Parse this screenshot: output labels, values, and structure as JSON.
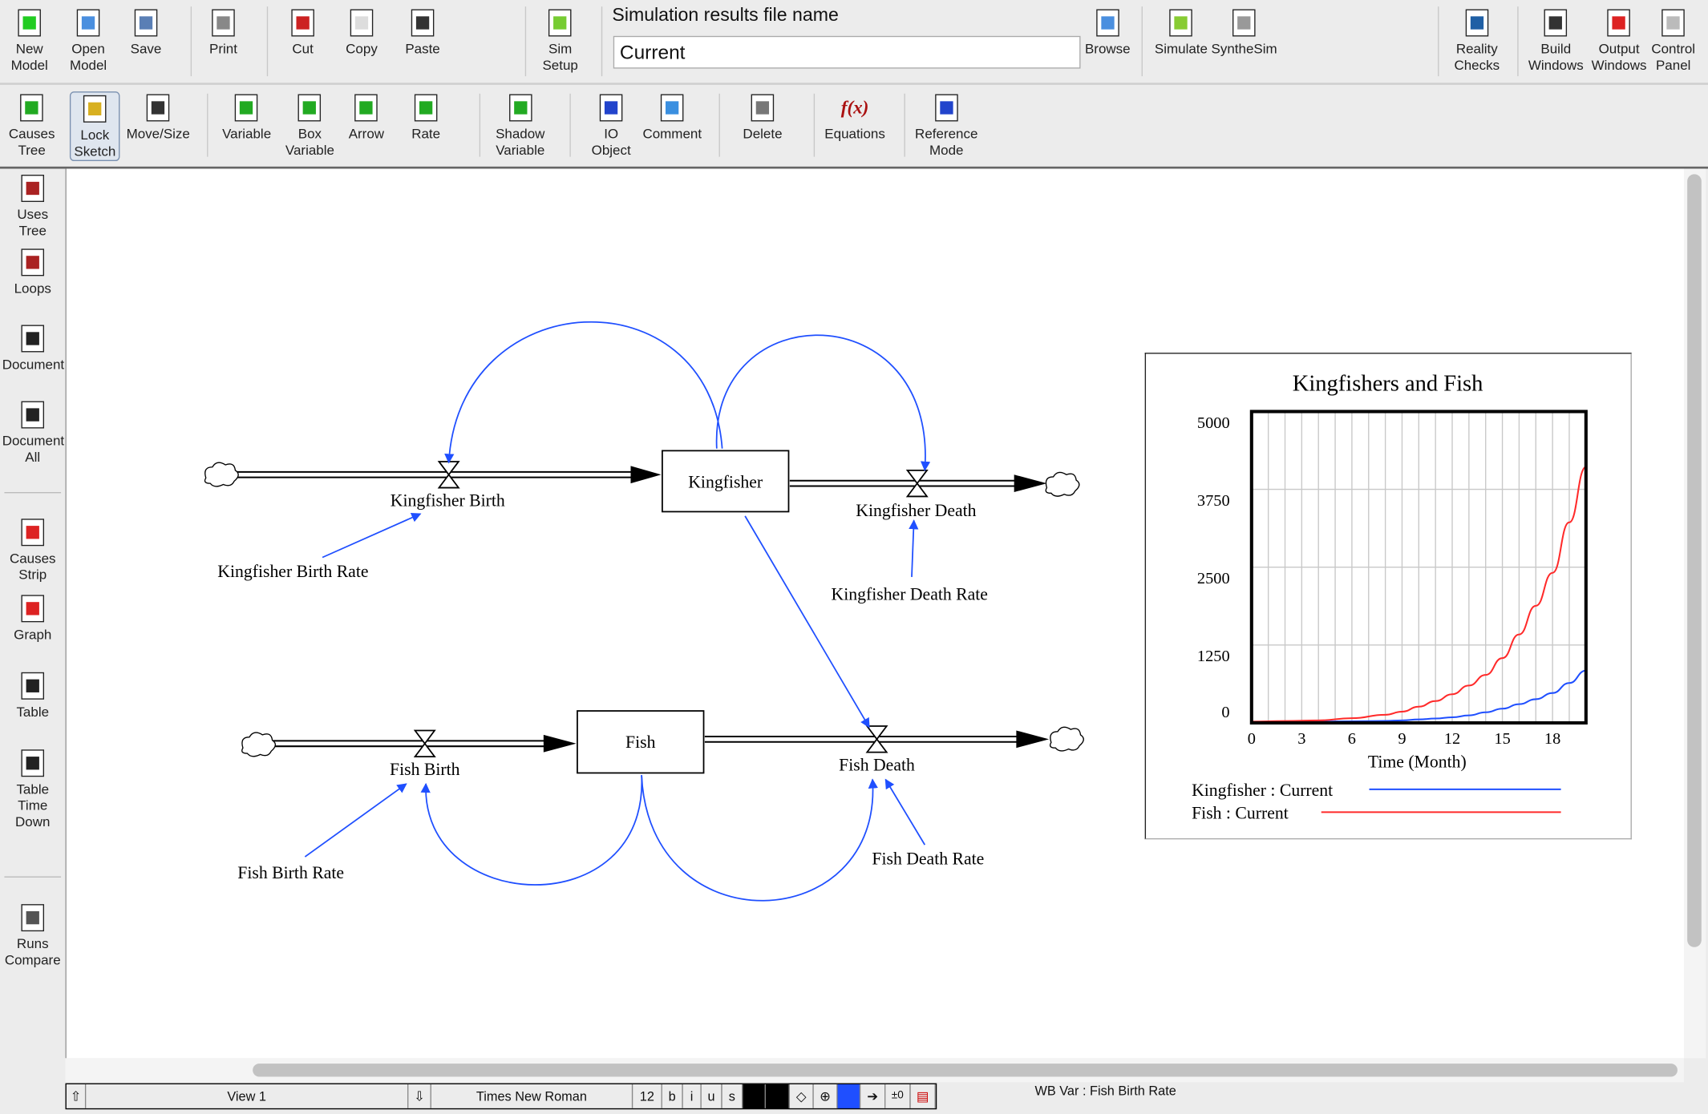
{
  "toolbar1": [
    {
      "label": "New\nModel",
      "icon": "new-model-icon",
      "x": 10
    },
    {
      "label": "Open\nModel",
      "icon": "open-folder-icon",
      "x": 64
    },
    {
      "label": "Save",
      "icon": "floppy-save-icon",
      "x": 119
    },
    {
      "label": "Print",
      "icon": "printer-icon",
      "x": 190
    },
    {
      "label": "Cut",
      "icon": "scissors-icon",
      "x": 263
    },
    {
      "label": "Copy",
      "icon": "copy-icon",
      "x": 317
    },
    {
      "label": "Paste",
      "icon": "paste-icon",
      "x": 372
    },
    {
      "label": "Sim\nSetup",
      "icon": "sim-setup-icon",
      "x": 498
    },
    {
      "label": "Browse",
      "icon": "browse-folder-icon",
      "x": 996
    },
    {
      "label": "Simulate",
      "icon": "play-icon",
      "x": 1060
    },
    {
      "label": "SyntheSim",
      "icon": "synthesim-icon",
      "x": 1112
    },
    {
      "label": "Reality\nChecks",
      "icon": "reality-check-icon",
      "x": 1335
    },
    {
      "label": "Build\nWindows",
      "icon": "build-windows-icon",
      "x": 1403
    },
    {
      "label": "Output\nWindows",
      "icon": "output-windows-icon",
      "x": 1461
    },
    {
      "label": "Control\nPanel",
      "icon": "control-panel-icon",
      "x": 1516
    }
  ],
  "sim_results": {
    "label": "Simulation results file name",
    "value": "Current"
  },
  "toolbar2": [
    {
      "label": "Causes\nTree",
      "icon": "causes-tree-icon",
      "x": 8
    },
    {
      "label": "Lock\nSketch",
      "icon": "lock-icon",
      "x": 64,
      "active": true
    },
    {
      "label": "Move/Size",
      "icon": "hand-icon",
      "x": 116
    },
    {
      "label": "Variable",
      "icon": "variable-icon",
      "x": 204
    },
    {
      "label": "Box\nVariable",
      "icon": "box-variable-icon",
      "x": 262
    },
    {
      "label": "Arrow",
      "icon": "arrow-tool-icon",
      "x": 320
    },
    {
      "label": "Rate",
      "icon": "rate-icon",
      "x": 376
    },
    {
      "label": "Shadow\nVariable",
      "icon": "shadow-variable-icon",
      "x": 455
    },
    {
      "label": "IO\nObject",
      "icon": "io-object-icon",
      "x": 543
    },
    {
      "label": "Comment",
      "icon": "comment-icon",
      "x": 590
    },
    {
      "label": "Delete",
      "icon": "trash-icon",
      "x": 682
    },
    {
      "label": "Equations",
      "icon": "equations-icon",
      "x": 757
    },
    {
      "label": "Reference\nMode",
      "icon": "reference-mode-icon",
      "x": 840
    }
  ],
  "sidebar": [
    {
      "label": "Uses\nTree",
      "icon": "uses-tree-icon",
      "y": 158
    },
    {
      "label": "Loops",
      "icon": "loops-icon",
      "y": 226
    },
    {
      "label": "Document",
      "icon": "document-icon",
      "y": 296
    },
    {
      "label": "Document\nAll",
      "icon": "document-all-icon",
      "y": 366
    },
    {
      "label": "Causes\nStrip",
      "icon": "causes-strip-icon",
      "y": 474
    },
    {
      "label": "Graph",
      "icon": "graph-icon",
      "y": 544
    },
    {
      "label": "Table",
      "icon": "table-icon",
      "y": 615
    },
    {
      "label": "Table\nTime\nDown",
      "icon": "table-time-down-icon",
      "y": 686
    },
    {
      "label": "Runs\nCompare",
      "icon": "runs-compare-icon",
      "y": 828
    }
  ],
  "diagram": {
    "stocks": [
      "Kingfisher",
      "Fish"
    ],
    "flows": [
      "Kingfisher Birth",
      "Kingfisher Death",
      "Fish Birth",
      "Fish Death"
    ],
    "auxiliaries": [
      "Kingfisher Birth Rate",
      "Kingfisher Death Rate",
      "Fish Birth Rate",
      "Fish Death Rate"
    ],
    "link_color": "#1f4fff"
  },
  "chart_data": {
    "type": "line",
    "title": "Kingfishers and Fish",
    "xlabel": "Time (Month)",
    "ylabel": "",
    "xlim": [
      0,
      20
    ],
    "ylim": [
      0,
      5000
    ],
    "xticks": [
      "0",
      "3",
      "6",
      "9",
      "12",
      "15",
      "18"
    ],
    "yticks": [
      "5000",
      "3750",
      "2500",
      "1250",
      "0"
    ],
    "grid": true,
    "legend_position": "bottom",
    "x": [
      0,
      2,
      4,
      6,
      8,
      9,
      10,
      11,
      12,
      13,
      14,
      15,
      16,
      17,
      18,
      19,
      20
    ],
    "series": [
      {
        "name": "Kingfisher : Current",
        "color": "#1f4fff",
        "values": [
          15,
          18,
          22,
          26,
          32,
          40,
          55,
          70,
          90,
          120,
          170,
          228,
          300,
          380,
          480,
          640,
          840
        ]
      },
      {
        "name": "Fish : Current",
        "color": "#ff2a2a",
        "values": [
          20,
          30,
          40,
          75,
          130,
          180,
          260,
          350,
          460,
          600,
          770,
          1040,
          1420,
          1880,
          2410,
          3220,
          4110
        ]
      }
    ]
  },
  "statusbar": {
    "view": "View 1",
    "font": "Times New Roman",
    "size": "12",
    "bold": "b",
    "italic": "i",
    "underline": "u",
    "strike": "s",
    "info": "WB Var : Fish Birth Rate"
  }
}
